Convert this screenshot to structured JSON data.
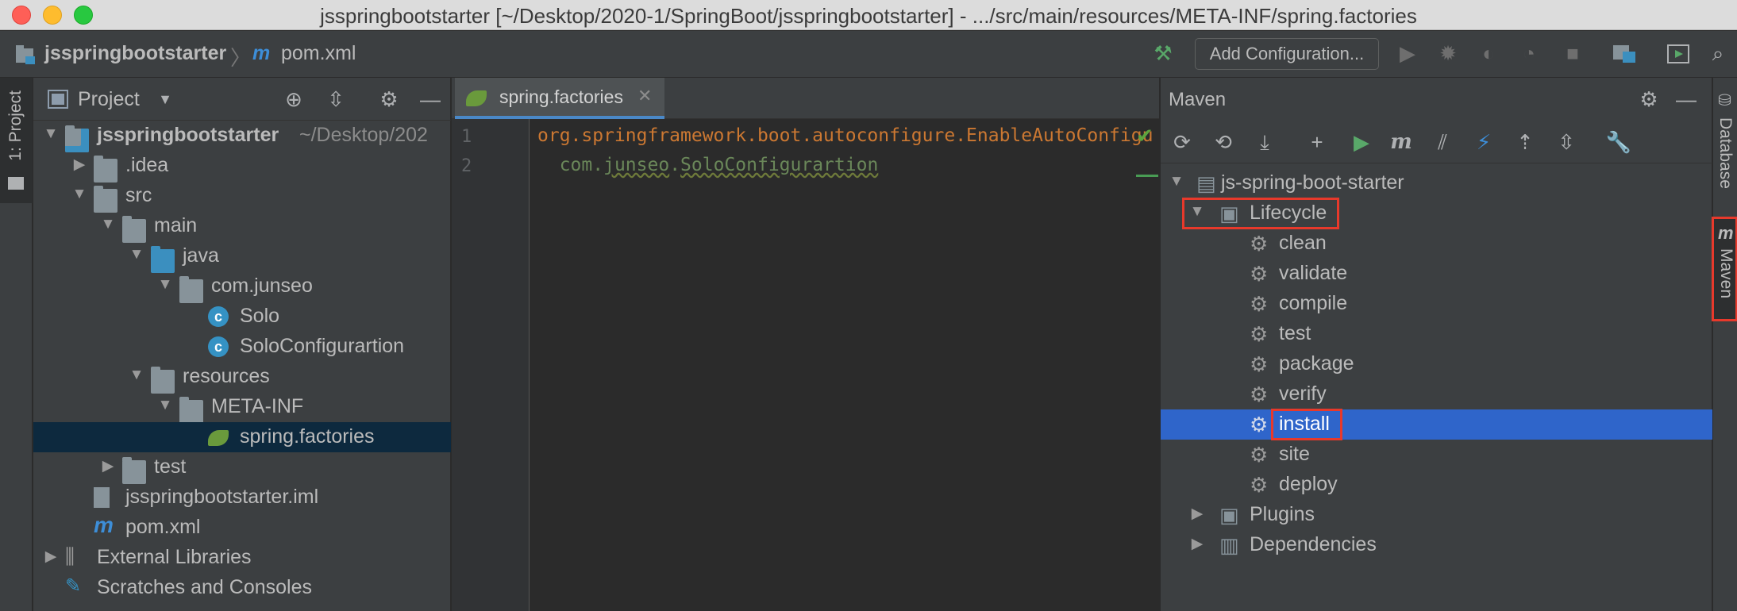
{
  "window": {
    "title": "jsspringbootstarter [~/Desktop/2020-1/SpringBoot/jsspringbootstarter] - .../src/main/resources/META-INF/spring.factories"
  },
  "navbar": {
    "project": "jsspringbootstarter",
    "file": "pom.xml",
    "add_configuration": "Add Configuration..."
  },
  "left_strip": {
    "project_tab": "1: Project"
  },
  "project_panel": {
    "title": "Project",
    "tree": [
      {
        "label": "jsspringbootstarter",
        "hint": "~/Desktop/202",
        "depth": 0,
        "expanded": true,
        "icon": "module-folder-icon",
        "bold": true
      },
      {
        "label": ".idea",
        "depth": 1,
        "expanded": false,
        "icon": "folder-icon"
      },
      {
        "label": "src",
        "depth": 1,
        "expanded": true,
        "icon": "folder-icon"
      },
      {
        "label": "main",
        "depth": 2,
        "expanded": true,
        "icon": "folder-icon"
      },
      {
        "label": "java",
        "depth": 3,
        "expanded": true,
        "icon": "source-folder-icon"
      },
      {
        "label": "com.junseo",
        "depth": 4,
        "expanded": true,
        "icon": "package-icon"
      },
      {
        "label": "Solo",
        "depth": 5,
        "icon": "class-icon"
      },
      {
        "label": "SoloConfigurartion",
        "depth": 5,
        "icon": "class-icon"
      },
      {
        "label": "resources",
        "depth": 3,
        "expanded": true,
        "icon": "resources-folder-icon"
      },
      {
        "label": "META-INF",
        "depth": 4,
        "expanded": true,
        "icon": "package-icon"
      },
      {
        "label": "spring.factories",
        "depth": 5,
        "icon": "spring-leaf-icon",
        "selected": true
      },
      {
        "label": "test",
        "depth": 2,
        "expanded": false,
        "icon": "folder-icon"
      },
      {
        "label": "jsspringbootstarter.iml",
        "depth": 1,
        "icon": "iml-file-icon"
      },
      {
        "label": "pom.xml",
        "depth": 1,
        "icon": "maven-m-icon"
      },
      {
        "label": "External Libraries",
        "depth": 0,
        "expanded": false,
        "icon": "libraries-icon"
      },
      {
        "label": "Scratches and Consoles",
        "depth": 0,
        "icon": "scratches-icon"
      }
    ]
  },
  "editor": {
    "tab": "spring.factories",
    "lines": [
      {
        "number": "1",
        "text": "org.springframework.boot.autoconfigure.EnableAutoConfigu"
      },
      {
        "number": "2",
        "prefix": "  com.",
        "underlined": "junseo",
        "rest": ".",
        "underlined2": "SoloConfigurartion"
      }
    ]
  },
  "maven_panel": {
    "title": "Maven",
    "project": "js-spring-boot-starter",
    "lifecycle_label": "Lifecycle",
    "phases": [
      "clean",
      "validate",
      "compile",
      "test",
      "package",
      "verify",
      "install",
      "site",
      "deploy"
    ],
    "selected_phase": "install",
    "plugins_label": "Plugins",
    "dependencies_label": "Dependencies"
  },
  "right_strip": {
    "database_tab": "Database",
    "maven_tab": "Maven"
  },
  "colors": {
    "selection": "#2f65ca",
    "highlight_box": "#e8392b",
    "key": "#cc7832",
    "value": "#6a8759"
  }
}
